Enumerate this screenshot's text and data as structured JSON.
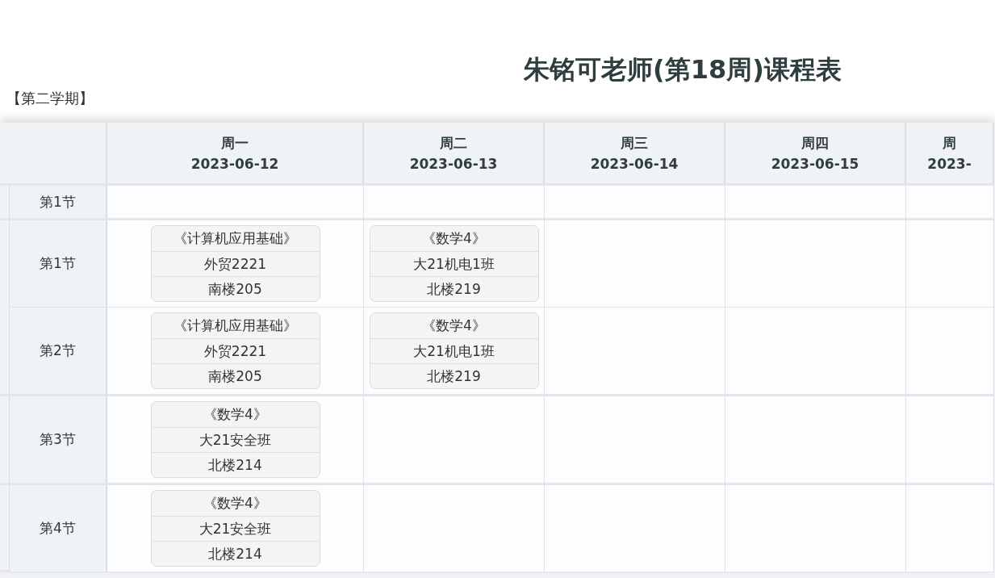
{
  "title": "朱铭可老师(第18周)课程表",
  "semester": "【第二学期】",
  "days": [
    {
      "name": "周一",
      "date": "2023-06-12"
    },
    {
      "name": "周二",
      "date": "2023-06-13"
    },
    {
      "name": "周三",
      "date": "2023-06-14"
    },
    {
      "name": "周四",
      "date": "2023-06-15"
    },
    {
      "name": "周",
      "date": "2023-"
    }
  ],
  "sections": [
    {
      "rows": [
        {
          "label": "第1节"
        }
      ]
    },
    {
      "rows": [
        {
          "label": "第1节",
          "courses": [
            {
              "name": "《计算机应用基础》",
              "class": "外贸2221",
              "room": "南楼205"
            },
            {
              "name": "《数学4》",
              "class": "大21机电1班",
              "room": "北楼219"
            }
          ]
        },
        {
          "label": "第2节",
          "courses": [
            {
              "name": "《计算机应用基础》",
              "class": "外贸2221",
              "room": "南楼205"
            },
            {
              "name": "《数学4》",
              "class": "大21机电1班",
              "room": "北楼219"
            }
          ]
        }
      ]
    },
    {
      "rows": [
        {
          "label": "第3节",
          "courses": [
            {
              "name": "《数学4》",
              "class": "大21安全班",
              "room": "北楼214"
            }
          ]
        }
      ]
    },
    {
      "rows": [
        {
          "label": "第4节",
          "courses": [
            {
              "name": "《数学4》",
              "class": "大21安全班",
              "room": "北楼214"
            }
          ]
        }
      ]
    }
  ]
}
